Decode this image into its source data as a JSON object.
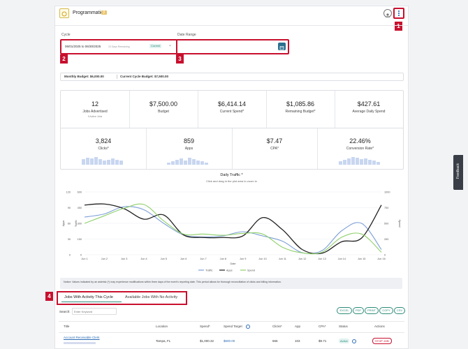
{
  "header": {
    "title": "Programmatic",
    "badge": "β"
  },
  "callouts": [
    "1",
    "2",
    "3",
    "4"
  ],
  "cycle": {
    "label": "Cycle",
    "value": "06/01/2025 to 06/30/2025",
    "days_remaining": "10 Days Remaining",
    "pill": "Current"
  },
  "date_range": {
    "label": "Date Range",
    "value": ""
  },
  "budget_bar": {
    "monthly": "Monthly Budget: $6,000.00",
    "current": "Current Cycle Budget: $7,500.00"
  },
  "stats_row1": [
    {
      "value": "12",
      "label": "Jobs Advertised",
      "sub": "9 Active Jobs"
    },
    {
      "value": "$7,500.00",
      "label": "Budget",
      "sub": ""
    },
    {
      "value": "$6,414.14",
      "label": "Current Spend*",
      "sub": ""
    },
    {
      "value": "$1,085.86",
      "label": "Remaining Budget*",
      "sub": ""
    },
    {
      "value": "$427.61",
      "label": "Average Daily Spend",
      "sub": ""
    }
  ],
  "stats_row2": [
    {
      "value": "3,824",
      "label": "Clicks*"
    },
    {
      "value": "859",
      "label": "Apps"
    },
    {
      "value": "$7.47",
      "label": "CPA*"
    },
    {
      "value": "22.46%",
      "label": "Conversion Rate*"
    }
  ],
  "chart_title": "Daily Traffic *",
  "chart_subtitle": "Click and drag in the plot area to zoom in",
  "chart_data": {
    "type": "line",
    "title": "Daily Traffic *",
    "xlabel": "Date",
    "x": [
      "Jun 1",
      "Jun 2",
      "Jun 3",
      "Jun 4",
      "Jun 5",
      "Jun 6",
      "Jun 7",
      "Jun 8",
      "Jun 9",
      "Jun 10",
      "Jun 11",
      "Jun 12",
      "Jun 13",
      "Jun 14",
      "Jun 15",
      "Jun 16"
    ],
    "left_axis_apps": {
      "label": "Apps",
      "ticks": [
        "0",
        "30",
        "60",
        "90",
        "120"
      ]
    },
    "left_axis_traffic": {
      "label": "Traffic",
      "ticks": [
        "0",
        "150",
        "300",
        "450",
        "600"
      ]
    },
    "right_axis_spend": {
      "label": "Spend",
      "ticks": [
        "0",
        "250",
        "500",
        "750",
        "1000"
      ]
    },
    "series": [
      {
        "name": "Traffic",
        "color": "#7d9fd8",
        "axis": "traffic",
        "values": [
          360,
          390,
          460,
          430,
          300,
          190,
          170,
          180,
          220,
          180,
          130,
          20,
          40,
          230,
          300,
          50
        ]
      },
      {
        "name": "Apps",
        "color": "#222222",
        "axis": "apps",
        "values": [
          95,
          97,
          88,
          68,
          76,
          38,
          33,
          33,
          36,
          71,
          48,
          10,
          3,
          25,
          32,
          95
        ]
      },
      {
        "name": "Spend",
        "color": "#8fd06a",
        "axis": "spend",
        "values": [
          500,
          620,
          740,
          800,
          540,
          330,
          330,
          310,
          340,
          330,
          120,
          30,
          40,
          280,
          330,
          40
        ]
      }
    ]
  },
  "notice": "Notice: Values indicated by an asterisk (*) may experience modifications within three days of the event's reporting date. This period allows for thorough reconciliation of clicks and billing information.",
  "tabs": [
    "Jobs With Activity This Cycle",
    "Available Jobs With No Activity"
  ],
  "search": {
    "label": "Search:",
    "placeholder": "Enter Keyword"
  },
  "export_buttons": [
    "EXCEL",
    "PDF",
    "PRINT",
    "COPY",
    "CSV"
  ],
  "table": {
    "headers": [
      "Title",
      "Location",
      "Spend*",
      "Spend Target",
      "Clicks*",
      "App",
      "CPA*",
      "Status",
      "Actions"
    ],
    "rows": [
      {
        "title": "Account Receivable Clerk",
        "location": "Tampa, FL",
        "spend": "$1,000.32",
        "target": "$600.00",
        "clicks": "666",
        "app": "103",
        "cpa": "$9.71",
        "status": "Active",
        "action": "STOP JOB"
      }
    ]
  },
  "feedback": "Feedback",
  "colors": {
    "accent": "#2e8b7a",
    "callout": "#c8102e",
    "feedback_bg": "#3a3f47"
  }
}
